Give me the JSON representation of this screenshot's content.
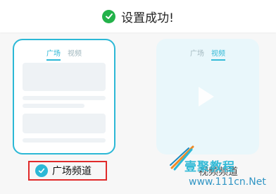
{
  "toast": {
    "message": "设置成功!",
    "icon": "check-circle-icon",
    "color": "#23b24a"
  },
  "options": {
    "left": {
      "tabs": [
        "广场",
        "视频"
      ],
      "active_tab": "广场",
      "label": "广场频道",
      "selected": true
    },
    "right": {
      "tabs": [
        "广场",
        "视频"
      ],
      "active_tab": "视频",
      "label": "视频频道",
      "selected": false
    }
  },
  "watermark": {
    "line1": "壹聚教程",
    "line2": "www.111cn.Net"
  },
  "colors": {
    "accent": "#2cb8d6",
    "highlight_border": "#e02a2a"
  }
}
